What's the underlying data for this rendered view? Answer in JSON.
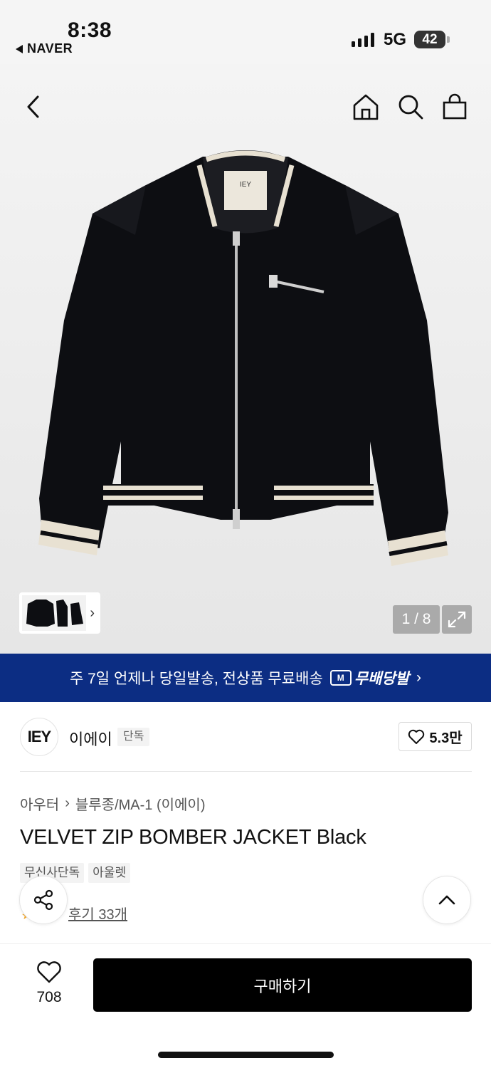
{
  "status_bar": {
    "time": "8:38",
    "back_app": "NAVER",
    "network": "5G",
    "battery": "42"
  },
  "header": {
    "icons": [
      "back-icon",
      "home-icon",
      "search-icon",
      "bag-icon"
    ]
  },
  "gallery": {
    "pager": "1 / 8",
    "current": 1,
    "total": 8,
    "thumb_chevron": "›"
  },
  "banner": {
    "text": "주 7일 언제나 당일발송, 전상품 무료배송",
    "badge_icon_text": "M",
    "badge": "무배당발",
    "chevron": "›"
  },
  "brand": {
    "logo": "IEY",
    "name": "이에이",
    "tag": "단독",
    "likes": "5.3만"
  },
  "product": {
    "breadcrumb": [
      "아우터",
      "블루종/MA-1 (이에이)"
    ],
    "breadcrumb_sep": "›",
    "title": "VELVET ZIP BOMBER JACKET Black",
    "chips": [
      "무신사단독",
      "아울렛"
    ],
    "reviews": "후기 33개"
  },
  "bottom_bar": {
    "wish_count": "708",
    "buy_label": "구매하기"
  },
  "colors": {
    "banner": "#0c2d83",
    "buy_button": "#000000"
  }
}
